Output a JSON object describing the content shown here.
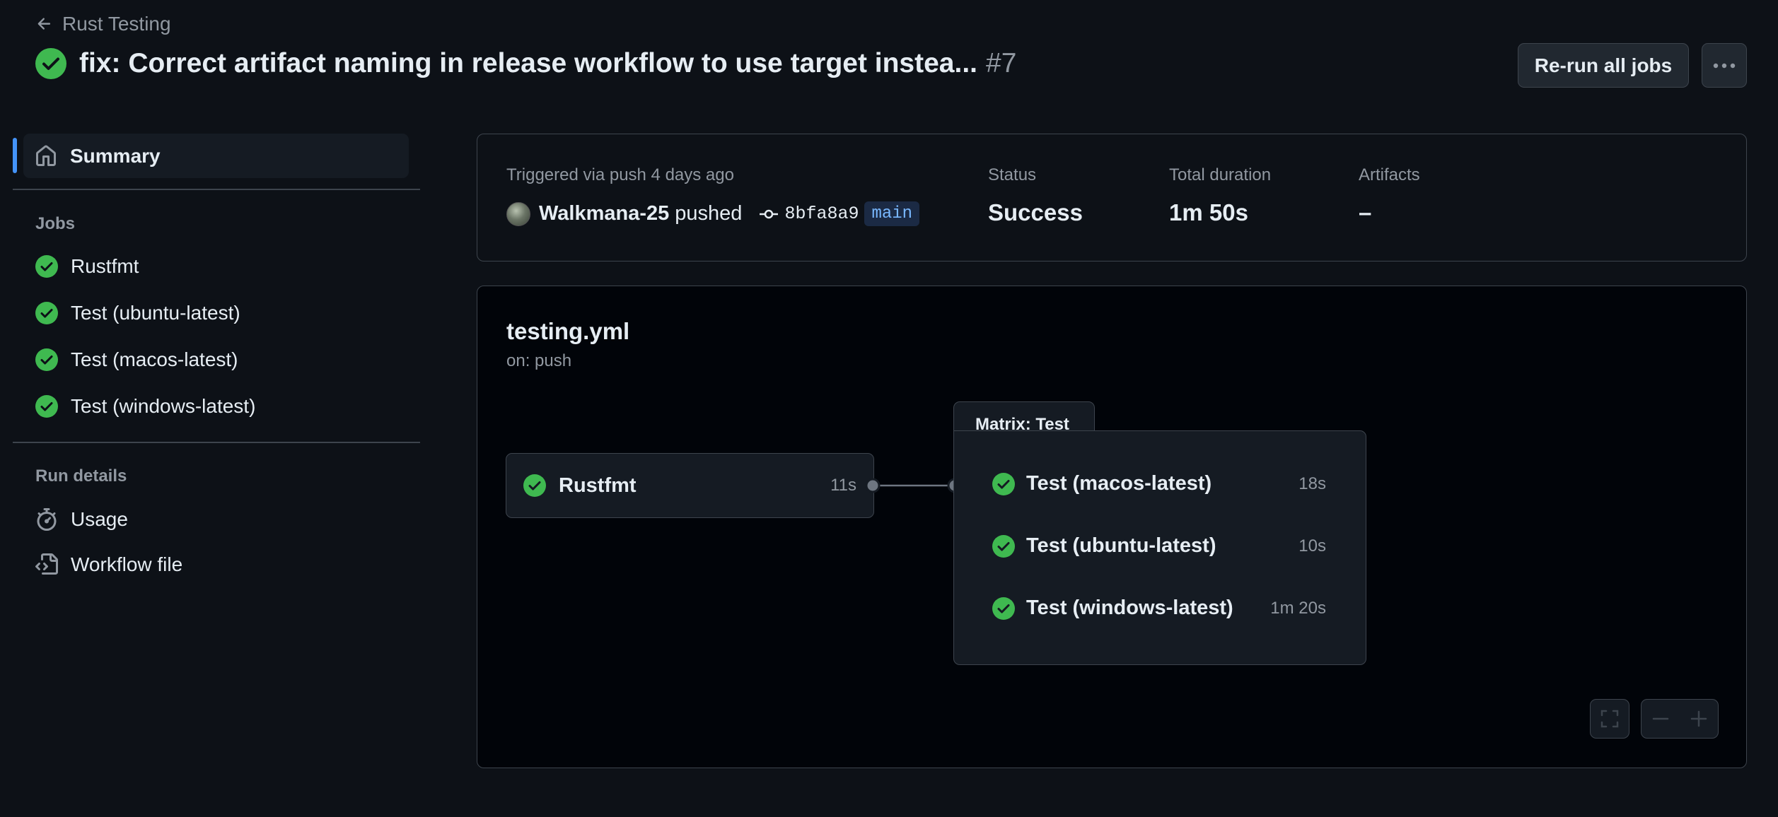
{
  "header": {
    "back_label": "Rust Testing",
    "title": "fix: Correct artifact naming in release workflow to use target instea...",
    "run_number": "#7",
    "rerun_label": "Re-run all jobs"
  },
  "sidebar": {
    "summary_label": "Summary",
    "jobs_heading": "Jobs",
    "jobs": [
      {
        "label": "Rustfmt"
      },
      {
        "label": "Test (ubuntu-latest)"
      },
      {
        "label": "Test (macos-latest)"
      },
      {
        "label": "Test (windows-latest)"
      }
    ],
    "run_details_heading": "Run details",
    "usage_label": "Usage",
    "workflow_file_label": "Workflow file"
  },
  "summary": {
    "trigger_text": "Triggered via push 4 days ago",
    "actor": "Walkmana-25",
    "pushed_word": "pushed",
    "commit_sha": "8bfa8a9",
    "branch": "main",
    "status_label": "Status",
    "status_value": "Success",
    "duration_label": "Total duration",
    "duration_value": "1m 50s",
    "artifacts_label": "Artifacts",
    "artifacts_value": "–"
  },
  "graph": {
    "workflow_name": "testing.yml",
    "trigger": "on: push",
    "job": {
      "name": "Rustfmt",
      "duration": "11s"
    },
    "matrix_label": "Matrix: Test",
    "matrix_jobs": [
      {
        "name": "Test (macos-latest)",
        "duration": "18s"
      },
      {
        "name": "Test (ubuntu-latest)",
        "duration": "10s"
      },
      {
        "name": "Test (windows-latest)",
        "duration": "1m 20s"
      }
    ]
  },
  "colors": {
    "background": "#0d1117",
    "success": "#3fb950",
    "accent": "#4493f8",
    "border": "#3d444d"
  }
}
